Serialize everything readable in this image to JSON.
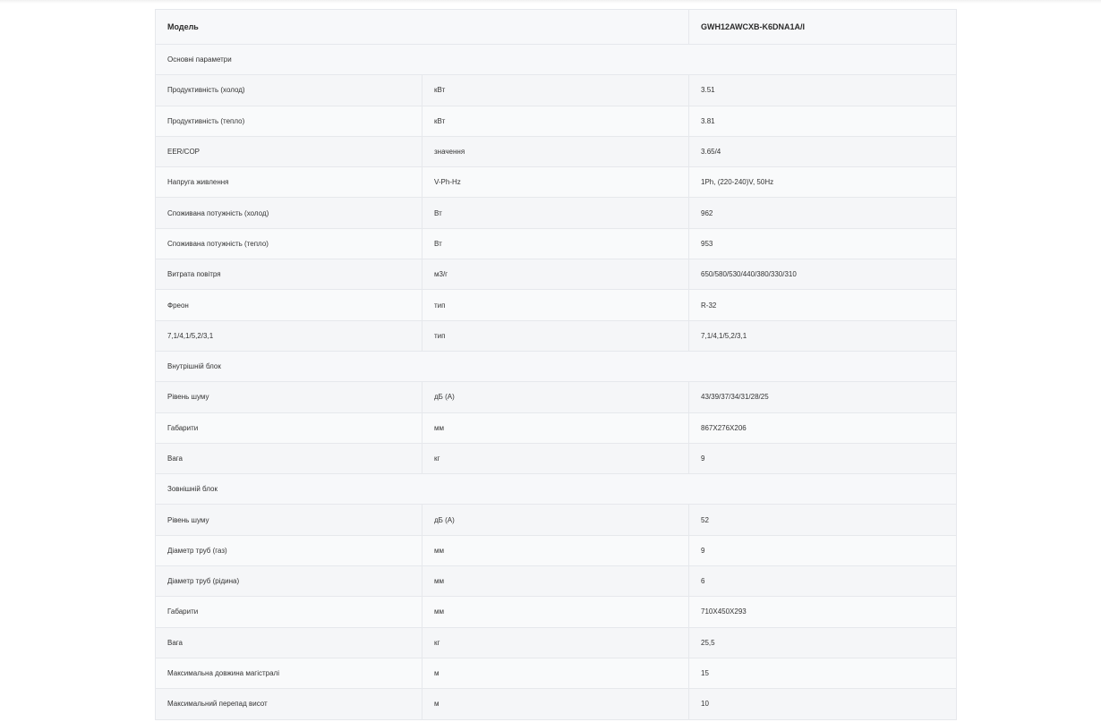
{
  "header": {
    "model_label": "Модель",
    "model_value": "GWH12AWCXB-K6DNA1A/I"
  },
  "rows": [
    {
      "type": "section",
      "label": "Основні параметри"
    },
    {
      "type": "row",
      "param": "Продуктивність (холод)",
      "unit": "кВт",
      "value": "3.51"
    },
    {
      "type": "row",
      "param": "Продуктивність (тепло)",
      "unit": "кВт",
      "value": "3.81"
    },
    {
      "type": "row",
      "param": "EER/COP",
      "unit": "значення",
      "value": "3.65/4"
    },
    {
      "type": "row",
      "param": "Напруга живлення",
      "unit": "V-Ph-Hz",
      "value": "1Ph, (220-240)V, 50Hz"
    },
    {
      "type": "row",
      "param": "Споживана потужність (холод)",
      "unit": "Вт",
      "value": "962"
    },
    {
      "type": "row",
      "param": "Споживана потужність (тепло)",
      "unit": "Вт",
      "value": "953"
    },
    {
      "type": "row",
      "param": "Витрата повітря",
      "unit": "м3/г",
      "value": "650/580/530/440/380/330/310"
    },
    {
      "type": "row",
      "param": "Фреон",
      "unit": "тип",
      "value": "R-32"
    },
    {
      "type": "row",
      "param": "7,1/4,1/5,2/3,1",
      "unit": "тип",
      "value": "7,1/4,1/5,2/3,1"
    },
    {
      "type": "section",
      "label": "Внутрішній блок"
    },
    {
      "type": "row",
      "param": "Рівень шуму",
      "unit": "дБ (А)",
      "value": "43/39/37/34/31/28/25"
    },
    {
      "type": "row",
      "param": "Габарити",
      "unit": "мм",
      "value": "867X276X206"
    },
    {
      "type": "row",
      "param": "Вага",
      "unit": "кг",
      "value": "9"
    },
    {
      "type": "section",
      "label": "Зовнішній блок"
    },
    {
      "type": "row",
      "param": "Рівень шуму",
      "unit": "дБ (А)",
      "value": "52"
    },
    {
      "type": "row",
      "param": "Діаметр труб (газ)",
      "unit": "мм",
      "value": "9"
    },
    {
      "type": "row",
      "param": "Діаметр труб (рідина)",
      "unit": "мм",
      "value": "6"
    },
    {
      "type": "row",
      "param": "Габарити",
      "unit": "мм",
      "value": "710X450X293"
    },
    {
      "type": "row",
      "param": "Вага",
      "unit": "кг",
      "value": "25,5"
    },
    {
      "type": "row",
      "param": "Максимальна довжина магістралі",
      "unit": "м",
      "value": "15"
    },
    {
      "type": "row",
      "param": "Максимальний перепад висот",
      "unit": "м",
      "value": "10"
    }
  ]
}
